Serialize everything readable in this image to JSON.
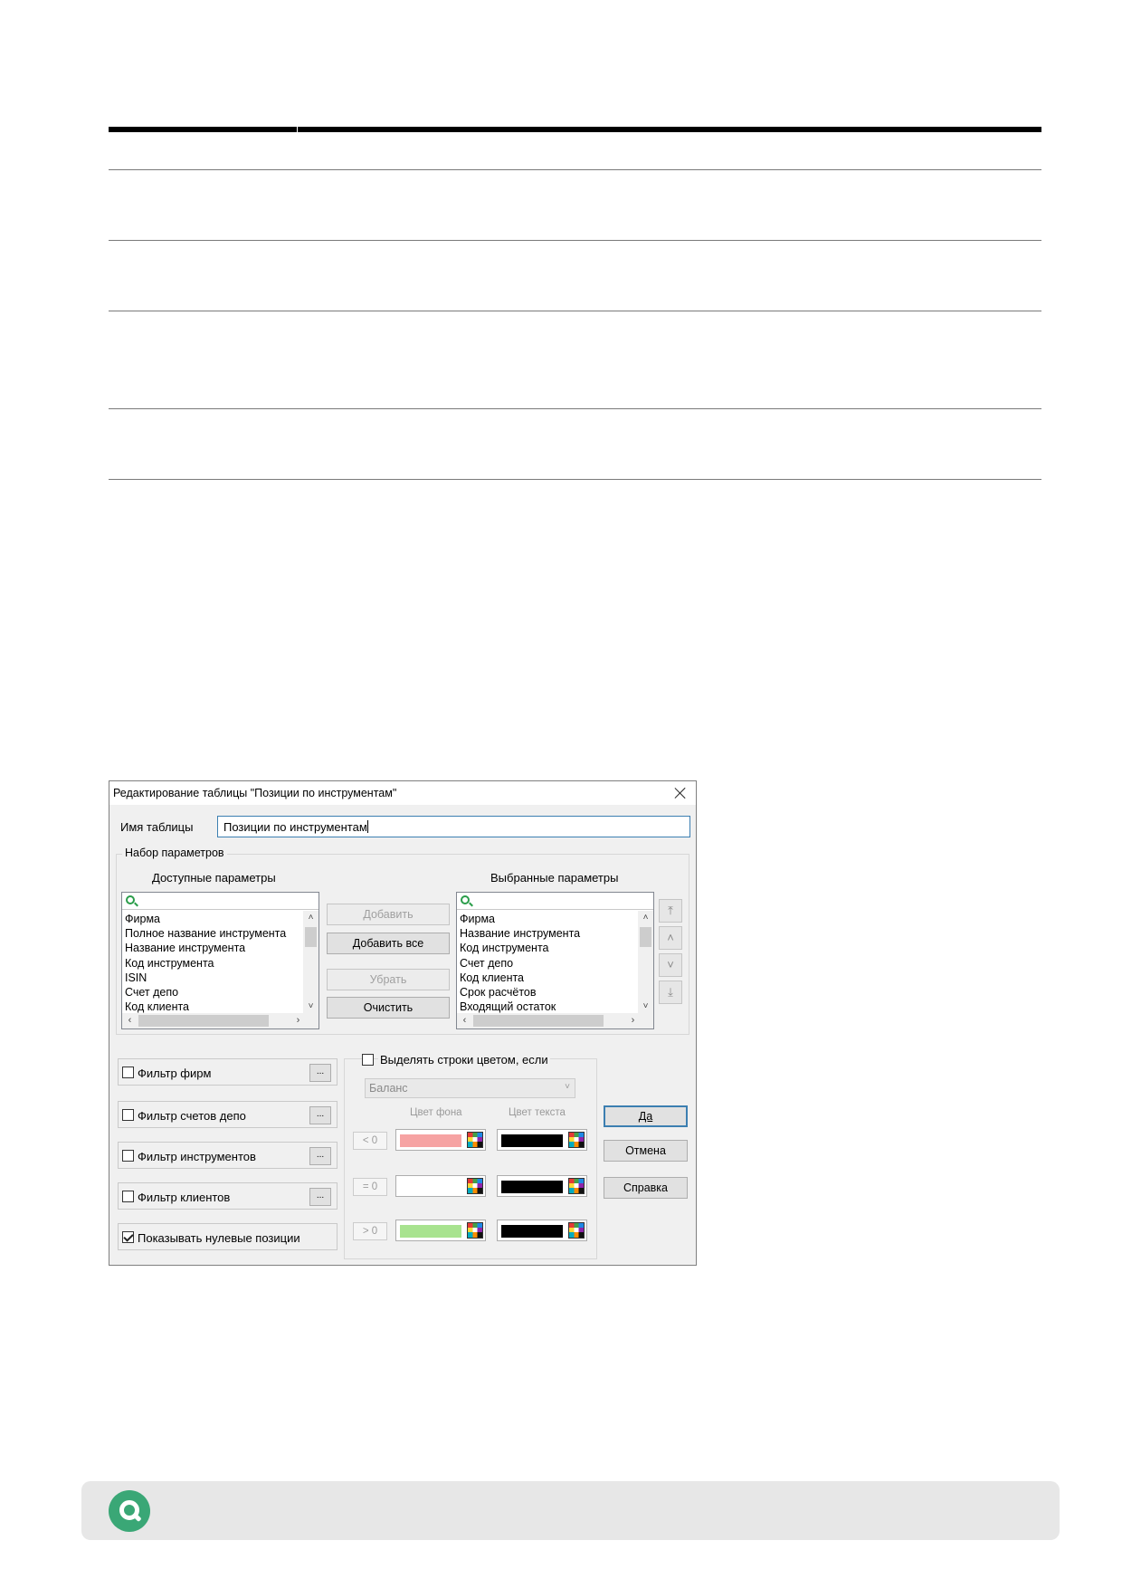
{
  "dialog": {
    "title": "Редактирование таблицы \"Позиции по инструментам\"",
    "table_name_label": "Имя таблицы",
    "table_name_value": "Позиции по инструментам",
    "params_group_label": "Набор параметров",
    "available_label": "Доступные параметры",
    "selected_label": "Выбранные параметры",
    "available_items": [
      "Фирма",
      "Полное название инструмента",
      "Название инструмента",
      "Код инструмента",
      "ISIN",
      "Счет депо",
      "Код клиента"
    ],
    "selected_items": [
      "Фирма",
      "Название инструмента",
      "Код инструмента",
      "Счет депо",
      "Код клиента",
      "Срок расчётов",
      "Входящий остаток"
    ],
    "buttons": {
      "add": "Добавить",
      "add_all": "Добавить все",
      "remove": "Убрать",
      "clear": "Очистить",
      "ok": "Да",
      "cancel": "Отмена",
      "help": "Справка"
    },
    "order_buttons": [
      "⤒",
      "˄",
      "˅",
      "⤓"
    ],
    "filters": [
      {
        "label": "Фильтр фирм",
        "checked": false
      },
      {
        "label": "Фильтр счетов депо",
        "checked": false
      },
      {
        "label": "Фильтр инструментов",
        "checked": false
      },
      {
        "label": "Фильтр клиентов",
        "checked": false
      }
    ],
    "filter_button_label": "...",
    "show_zero_label": "Показывать нулевые позиции",
    "show_zero_checked": true,
    "highlight_label": "Выделять строки цветом, если",
    "highlight_checked": false,
    "highlight_field": "Баланс",
    "bg_color_label": "Цвет фона",
    "text_color_label": "Цвет текста",
    "conditions": [
      {
        "op": "< 0",
        "bg": "#f6a3a3",
        "text": "#000000"
      },
      {
        "op": "= 0",
        "bg": "#ffffff",
        "text": "#000000"
      },
      {
        "op": "> 0",
        "bg": "#a8e38f",
        "text": "#000000"
      }
    ]
  },
  "colors": {
    "accent": "#3c7fb1",
    "footer_logo": "#3aa776",
    "footer_bg": "#e7e7e7"
  },
  "icons": [
    "search-icon",
    "close-icon",
    "palette-icon",
    "scroll-arrow-icon",
    "logo-icon"
  ]
}
